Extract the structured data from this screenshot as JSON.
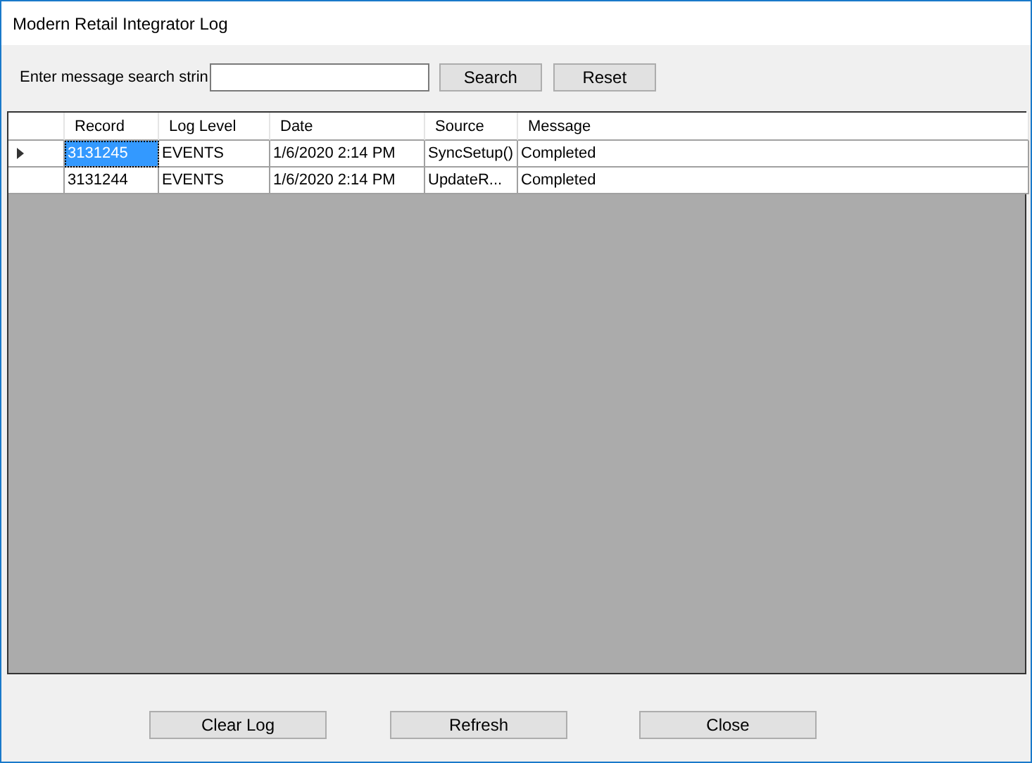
{
  "window": {
    "title": "Modern Retail Integrator Log"
  },
  "search": {
    "label": "Enter message search strin",
    "buttons": [
      "Search",
      "Reset"
    ]
  },
  "table": {
    "columns": [
      "Record",
      "Log Level",
      "Date",
      "Source",
      "Message"
    ],
    "rows": [
      {
        "selected": true,
        "cells": [
          "3131245",
          "EVENTS",
          "1/6/2020 2:14 PM",
          "SyncSetup()",
          "Completed"
        ]
      },
      {
        "selected": false,
        "cells": [
          "3131244",
          "EVENTS",
          "1/6/2020 2:14 PM",
          "UpdateR...",
          "Completed"
        ]
      }
    ]
  },
  "buttons": [
    "Clear Log",
    "Refresh",
    "Close"
  ]
}
